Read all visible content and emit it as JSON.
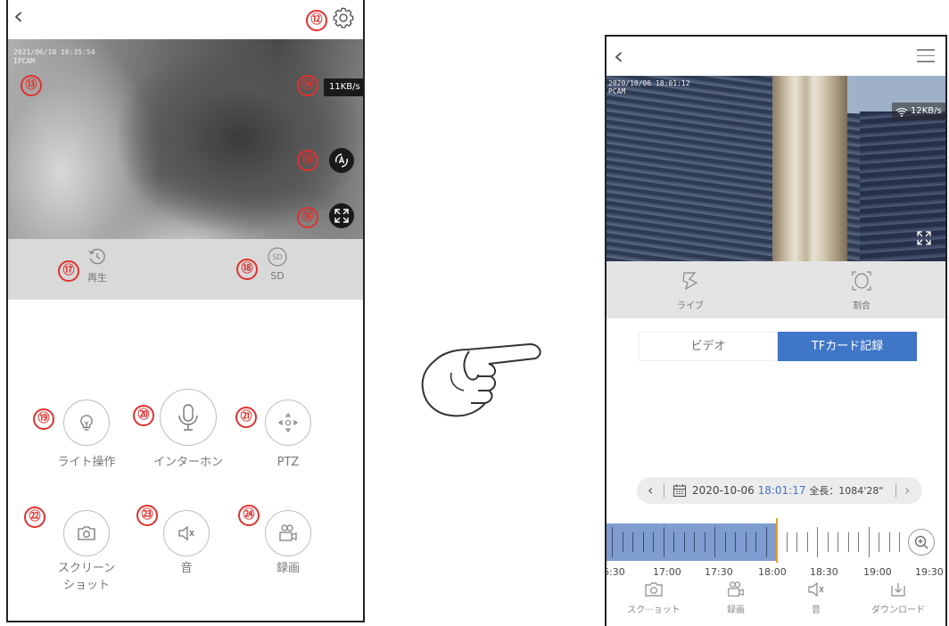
{
  "left_screen": {
    "osd_timestamp": "2021/06/10 16:35:54",
    "osd_camera": "IPCAM",
    "bitrate": "11KB/s",
    "tabs": [
      {
        "label": "再生",
        "icon": "history-icon"
      },
      {
        "label": "SD",
        "icon": "sd-card-icon"
      }
    ],
    "controls": [
      {
        "label": "ライト操作",
        "icon": "lightbulb-icon"
      },
      {
        "label": "インターホン",
        "icon": "microphone-icon"
      },
      {
        "label": "PTZ",
        "icon": "ptz-icon"
      },
      {
        "label": "スクリーン\nショット",
        "icon": "camera-icon"
      },
      {
        "label": "音",
        "icon": "speaker-mute-icon"
      },
      {
        "label": "録画",
        "icon": "video-record-icon"
      }
    ],
    "callouts": [
      "⑫",
      "⑬",
      "⑭",
      "⑮",
      "⑯",
      "⑰",
      "⑱",
      "⑲",
      "⑳",
      "㉑",
      "㉒",
      "㉓",
      "㉔"
    ]
  },
  "right_screen": {
    "osd_timestamp": "2020/10/06 18:01:12",
    "osd_camera": "PCAM",
    "bitrate": "12KB/s",
    "tabs": [
      {
        "label": "ライブ",
        "icon": "live-icon"
      },
      {
        "label": "割合",
        "icon": "aspect-ratio-icon"
      }
    ],
    "segments": {
      "video": "ビデオ",
      "tf_card": "TFカード記録"
    },
    "date_bar": {
      "date": "2020-10-06",
      "time": "18:01:17",
      "duration": "全長：1084'28\""
    },
    "timeline_labels": [
      "6:30",
      "17:00",
      "17:30",
      "18:00",
      "18:30",
      "19:00",
      "19:30"
    ],
    "bottom_bar": [
      {
        "label": "スク···ョット",
        "icon": "camera-icon"
      },
      {
        "label": "録画",
        "icon": "video-record-icon"
      },
      {
        "label": "音",
        "icon": "speaker-mute-icon"
      },
      {
        "label": "ダウンロード",
        "icon": "download-icon"
      }
    ]
  },
  "colors": {
    "accent_blue": "#3f76c7",
    "callout_red": "#e0312e",
    "timeline_fill": "#7f9dd0"
  }
}
